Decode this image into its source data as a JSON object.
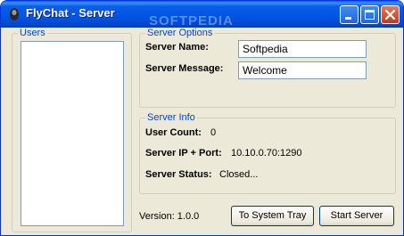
{
  "window": {
    "title": "FlyChat - Server",
    "watermark": "SOFTPEDIA"
  },
  "users": {
    "legend": "Users",
    "items": []
  },
  "server_options": {
    "legend": "Server Options",
    "name_label": "Server Name:",
    "name_value": "Softpedia",
    "message_label": "Server Message:",
    "message_value": "Welcome"
  },
  "server_info": {
    "legend": "Server Info",
    "user_count_label": "User Count:",
    "user_count_value": "0",
    "ip_port_label": "Server IP + Port:",
    "ip_port_value": "10.10.0.70:1290",
    "status_label": "Server Status:",
    "status_value": "Closed..."
  },
  "footer": {
    "version": "Version: 1.0.0",
    "tray_button": "To System Tray",
    "start_button": "Start Server"
  },
  "icons": {
    "app": "flychat-app-icon",
    "minimize": "minimize-icon",
    "maximize": "maximize-icon",
    "close": "close-icon"
  }
}
